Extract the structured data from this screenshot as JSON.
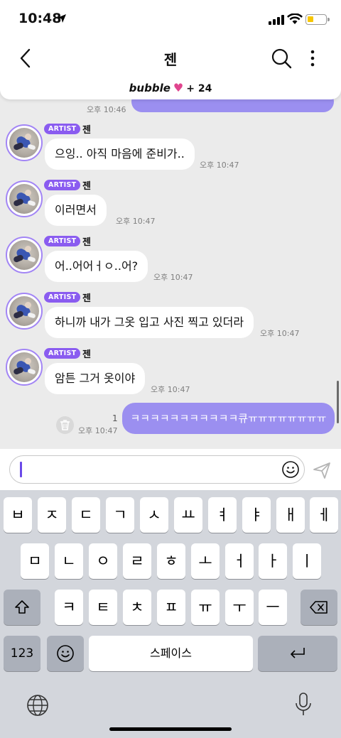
{
  "status_bar": {
    "time": "10:48"
  },
  "header": {
    "title": "젠"
  },
  "banner": {
    "label": "bubble",
    "count": "+ 24"
  },
  "previous_message_time": "오후 10:46",
  "messages": [
    {
      "badge": "ARTIST",
      "name": "젠",
      "text": "으잉.. 아직 마음에 준비가..",
      "time": "오후 10:47"
    },
    {
      "badge": "ARTIST",
      "name": "젠",
      "text": "이러면서",
      "time": "오후 10:47"
    },
    {
      "badge": "ARTIST",
      "name": "젠",
      "text": "어..어어ㅓㅇ..어?",
      "time": "오후 10:47"
    },
    {
      "badge": "ARTIST",
      "name": "젠",
      "text": "하니까 내가 그옷 입고 사진 찍고 있더라",
      "time": "오후 10:47"
    },
    {
      "badge": "ARTIST",
      "name": "젠",
      "text": "암튼 그거 옷이야",
      "time": "오후 10:47"
    }
  ],
  "my_message": {
    "text": "ㅋㅋㅋㅋㅋㅋㅋㅋㅋㅋㅋ큐ㅠㅠㅠㅠㅠㅠㅠㅠ",
    "time": "오후 10:47",
    "unread": "1"
  },
  "input": {
    "value": ""
  },
  "keyboard": {
    "row1": [
      "ㅂ",
      "ㅈ",
      "ㄷ",
      "ㄱ",
      "ㅅ",
      "ㅛ",
      "ㅕ",
      "ㅑ",
      "ㅐ",
      "ㅔ"
    ],
    "row2": [
      "ㅁ",
      "ㄴ",
      "ㅇ",
      "ㄹ",
      "ㅎ",
      "ㅗ",
      "ㅓ",
      "ㅏ",
      "ㅣ"
    ],
    "row3": [
      "ㅋ",
      "ㅌ",
      "ㅊ",
      "ㅍ",
      "ㅠ",
      "ㅜ",
      "ㅡ"
    ],
    "num_key": "123",
    "space_key": "스페이스"
  },
  "icons": {
    "back": "chevron-left-icon",
    "search": "search-icon",
    "more": "more-vertical-icon",
    "heart": "heart-icon",
    "emoji": "smiley-icon",
    "send": "send-icon",
    "trash": "trash-icon",
    "shift": "shift-icon",
    "delete": "backspace-icon",
    "return": "return-icon",
    "globe": "globe-icon",
    "mic": "mic-icon"
  },
  "colors": {
    "accent": "#8a5cf0",
    "my_bubble": "#9b8ff0",
    "chat_bg": "#ebebeb",
    "heart": "#e0458e"
  }
}
